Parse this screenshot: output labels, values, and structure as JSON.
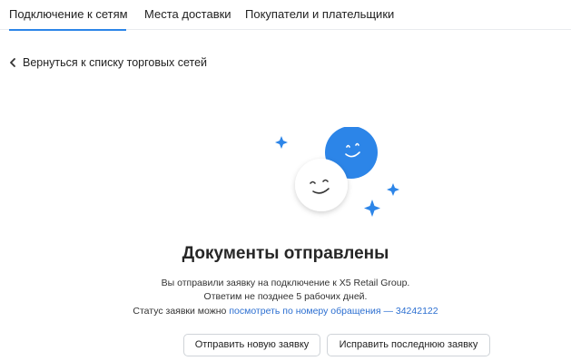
{
  "tabs": [
    {
      "label": "Подключение к сетям",
      "active": true
    },
    {
      "label": "Места доставки",
      "active": false
    },
    {
      "label": "Покупатели и плательщики",
      "active": false
    }
  ],
  "back_link": {
    "label": "Вернуться к списку торговых сетей",
    "icon": "chevron-left-icon"
  },
  "illustration": {
    "icons": [
      "sparkle-icon",
      "smiley-blue-icon",
      "smiley-white-icon"
    ],
    "colors": {
      "blue": "#2c85e8",
      "sparkle": "#2c85e8",
      "white_face": "#ffffff"
    }
  },
  "result": {
    "title": "Документы отправлены",
    "line1": "Вы отправили заявку на подключение к X5 Retail Group.",
    "line2": "Ответим не позднее 5 рабочих дней.",
    "line3_prefix": "Статус заявки можно ",
    "line3_link": "посмотреть по номеру обращения — 34242122"
  },
  "buttons": {
    "new_request": "Отправить новую заявку",
    "fix_last": "Исправить последнюю заявку"
  },
  "colors": {
    "accent": "#2c85e8",
    "link": "#2c6fd1",
    "divider": "#e9ebee"
  }
}
